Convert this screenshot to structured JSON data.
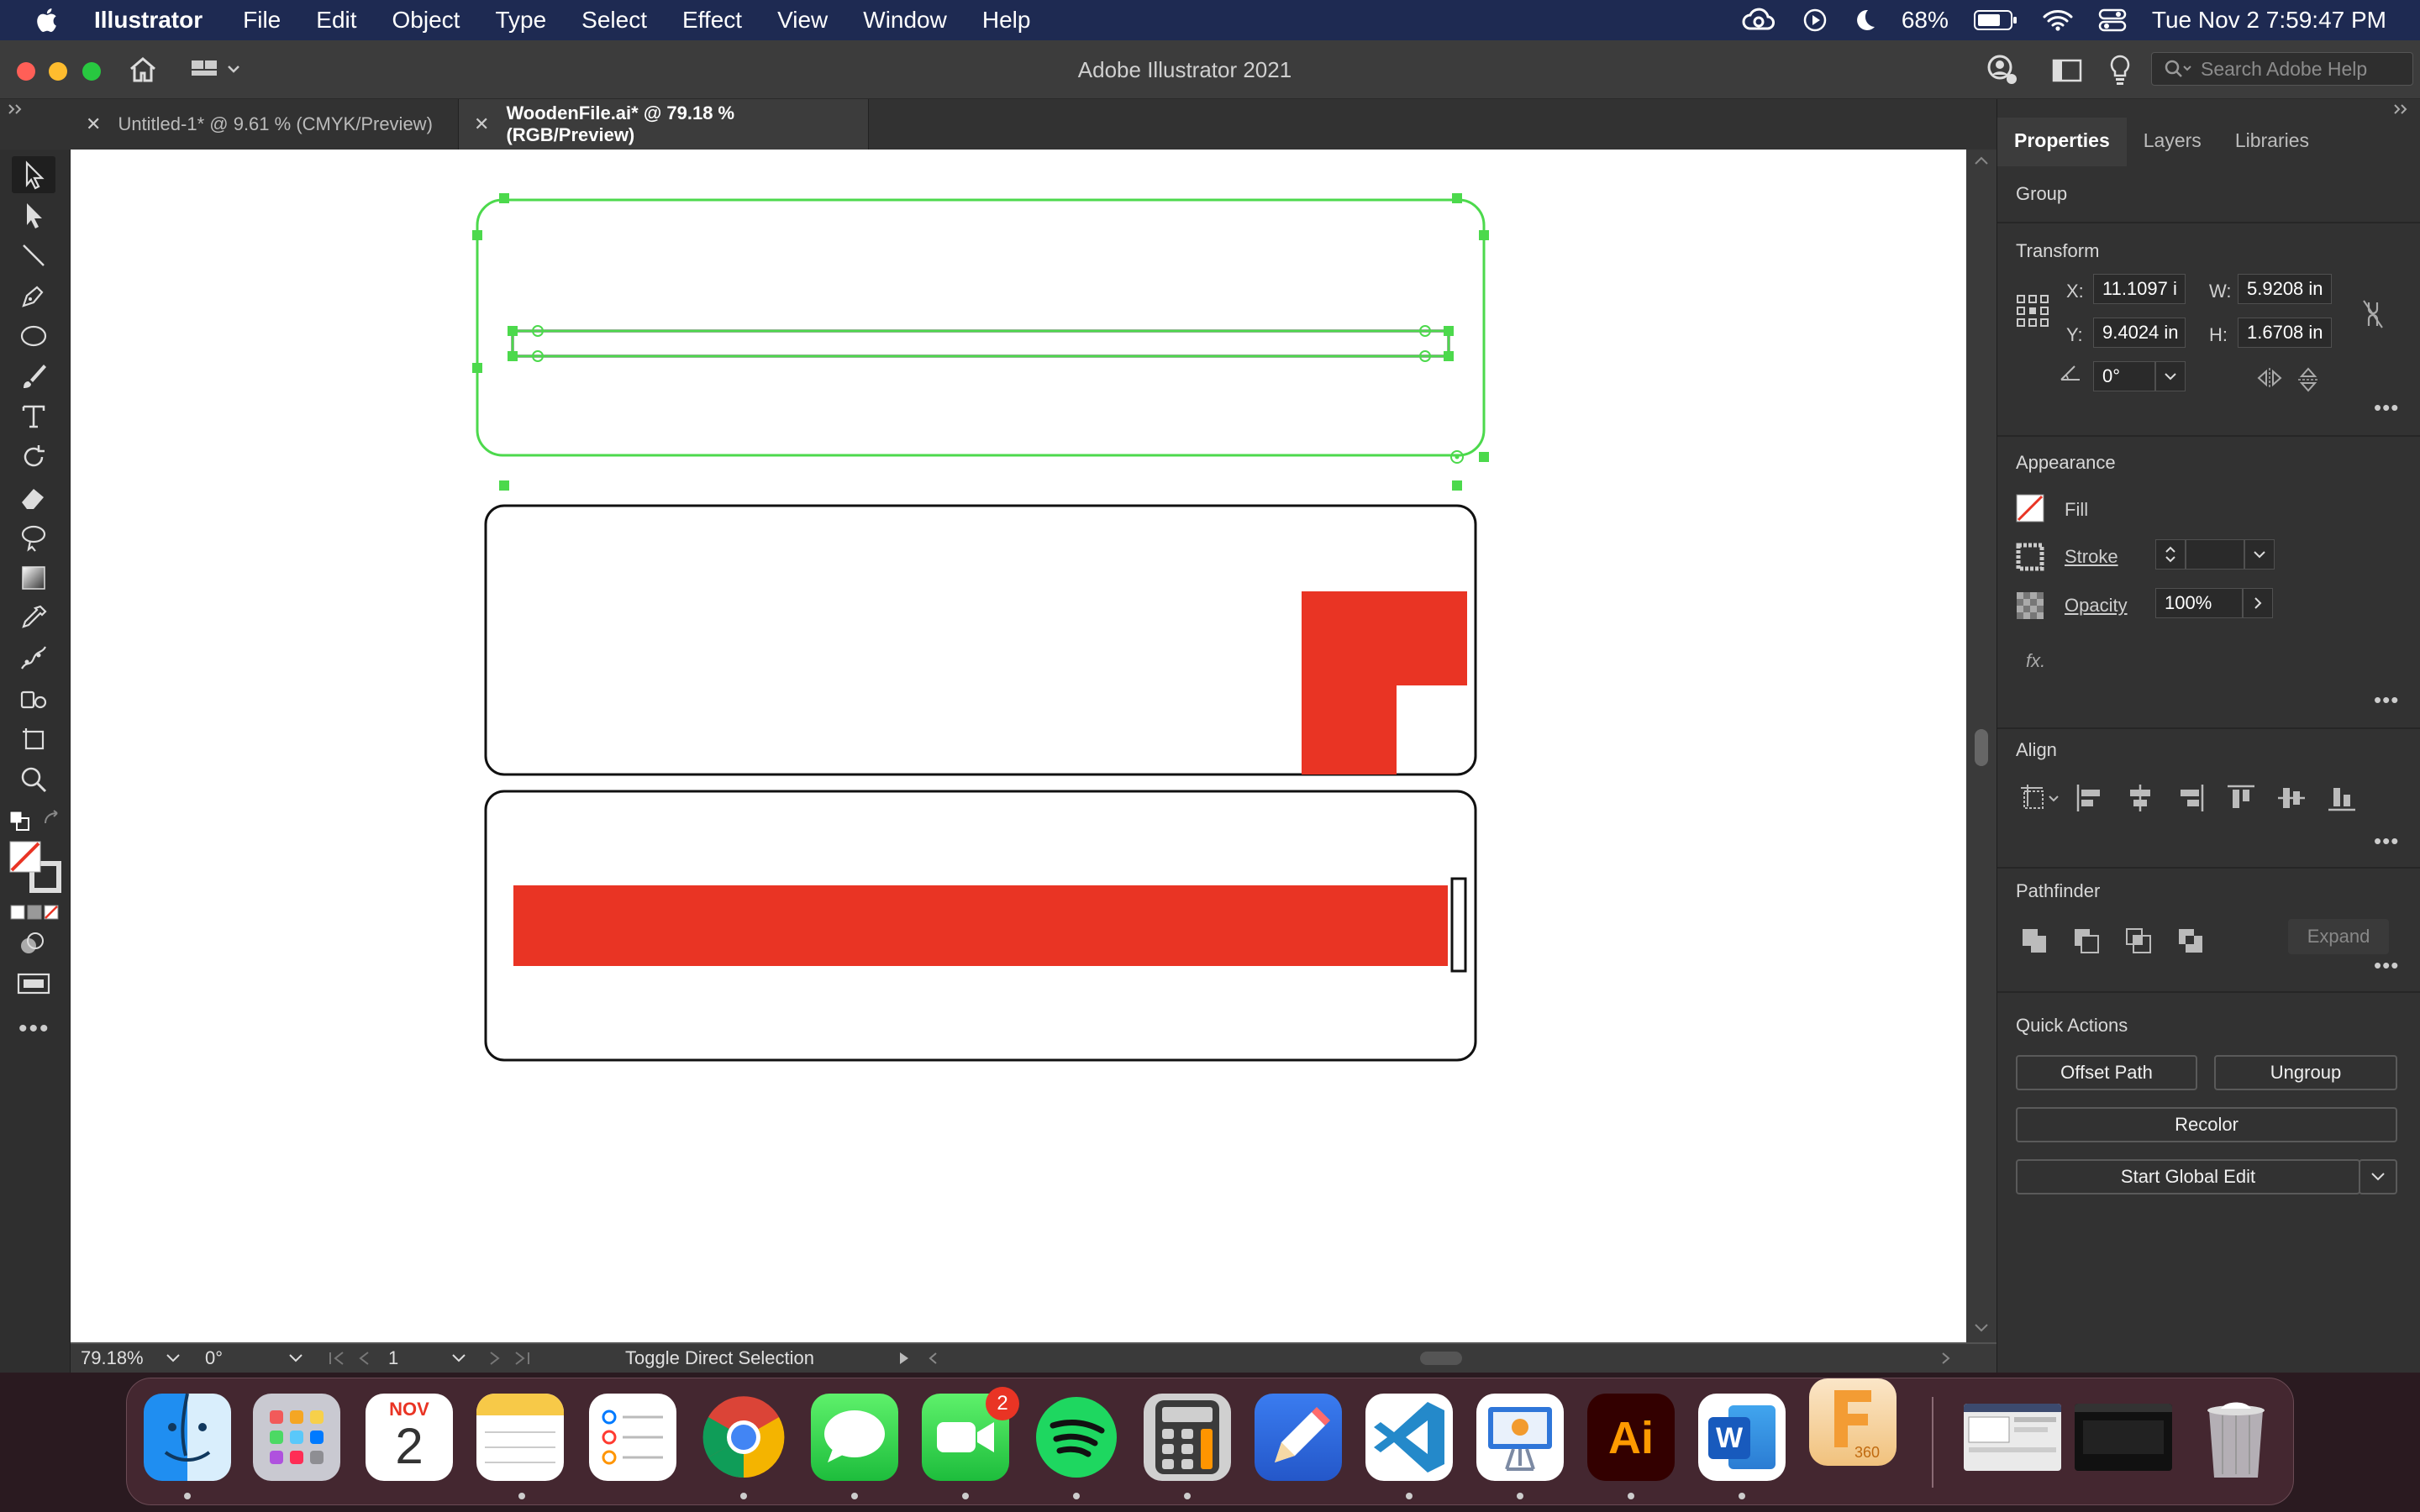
{
  "menubar": {
    "app_name": "Illustrator",
    "menus": [
      "File",
      "Edit",
      "Object",
      "Type",
      "Select",
      "Effect",
      "View",
      "Window",
      "Help"
    ],
    "battery": "68%",
    "datetime": "Tue Nov 2  7:59:47 PM"
  },
  "window": {
    "title": "Adobe Illustrator 2021",
    "search_placeholder": "Search Adobe Help"
  },
  "tabs": [
    {
      "label": "Untitled-1* @ 9.61 % (CMYK/Preview)",
      "active": false
    },
    {
      "label": "WoodenFile.ai* @ 79.18 % (RGB/Preview)",
      "active": true
    }
  ],
  "status": {
    "zoom": "79.18%",
    "rotation": "0°",
    "artboard": "1",
    "tool_hint": "Toggle Direct Selection"
  },
  "properties": {
    "tabs": [
      "Properties",
      "Layers",
      "Libraries"
    ],
    "selection_type": "Group",
    "transform": {
      "title": "Transform",
      "x_label": "X:",
      "x": "11.1097 i",
      "y_label": "Y:",
      "y": "9.4024 in",
      "w_label": "W:",
      "w": "5.9208 in",
      "h_label": "H:",
      "h": "1.6708 in",
      "angle": "0°"
    },
    "appearance": {
      "title": "Appearance",
      "fill_label": "Fill",
      "stroke_label": "Stroke",
      "opacity_label": "Opacity",
      "opacity": "100%",
      "fx_label": "fx."
    },
    "align": {
      "title": "Align"
    },
    "pathfinder": {
      "title": "Pathfinder",
      "expand_label": "Expand"
    },
    "quick_actions": {
      "title": "Quick Actions",
      "offset_path": "Offset Path",
      "ungroup": "Ungroup",
      "recolor": "Recolor",
      "global_edit": "Start Global Edit"
    }
  },
  "dock": {
    "calendar_month": "NOV",
    "calendar_day": "2",
    "facetime_badge": "2",
    "illustrator_label": "Ai",
    "word_label": "W",
    "fusion_label": "360"
  },
  "colors": {
    "accent_red": "#e93424",
    "selection_green": "#4cd94c",
    "menubar": "#1e2a52"
  }
}
